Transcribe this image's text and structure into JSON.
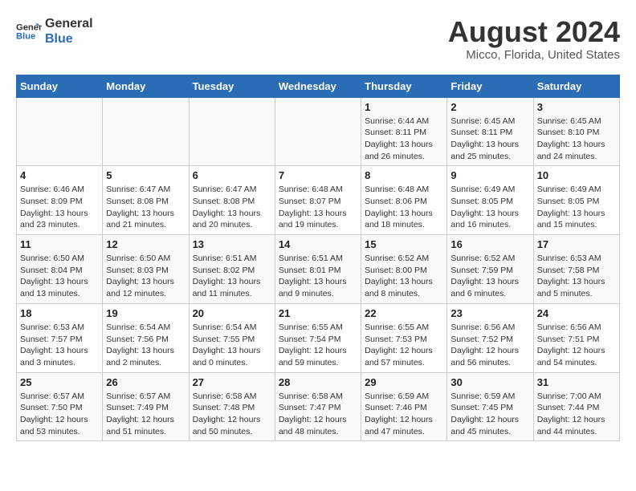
{
  "logo": {
    "line1": "General",
    "line2": "Blue"
  },
  "title": "August 2024",
  "location": "Micco, Florida, United States",
  "days_header": [
    "Sunday",
    "Monday",
    "Tuesday",
    "Wednesday",
    "Thursday",
    "Friday",
    "Saturday"
  ],
  "weeks": [
    [
      {
        "num": "",
        "info": ""
      },
      {
        "num": "",
        "info": ""
      },
      {
        "num": "",
        "info": ""
      },
      {
        "num": "",
        "info": ""
      },
      {
        "num": "1",
        "info": "Sunrise: 6:44 AM\nSunset: 8:11 PM\nDaylight: 13 hours\nand 26 minutes."
      },
      {
        "num": "2",
        "info": "Sunrise: 6:45 AM\nSunset: 8:11 PM\nDaylight: 13 hours\nand 25 minutes."
      },
      {
        "num": "3",
        "info": "Sunrise: 6:45 AM\nSunset: 8:10 PM\nDaylight: 13 hours\nand 24 minutes."
      }
    ],
    [
      {
        "num": "4",
        "info": "Sunrise: 6:46 AM\nSunset: 8:09 PM\nDaylight: 13 hours\nand 23 minutes."
      },
      {
        "num": "5",
        "info": "Sunrise: 6:47 AM\nSunset: 8:08 PM\nDaylight: 13 hours\nand 21 minutes."
      },
      {
        "num": "6",
        "info": "Sunrise: 6:47 AM\nSunset: 8:08 PM\nDaylight: 13 hours\nand 20 minutes."
      },
      {
        "num": "7",
        "info": "Sunrise: 6:48 AM\nSunset: 8:07 PM\nDaylight: 13 hours\nand 19 minutes."
      },
      {
        "num": "8",
        "info": "Sunrise: 6:48 AM\nSunset: 8:06 PM\nDaylight: 13 hours\nand 18 minutes."
      },
      {
        "num": "9",
        "info": "Sunrise: 6:49 AM\nSunset: 8:05 PM\nDaylight: 13 hours\nand 16 minutes."
      },
      {
        "num": "10",
        "info": "Sunrise: 6:49 AM\nSunset: 8:05 PM\nDaylight: 13 hours\nand 15 minutes."
      }
    ],
    [
      {
        "num": "11",
        "info": "Sunrise: 6:50 AM\nSunset: 8:04 PM\nDaylight: 13 hours\nand 13 minutes."
      },
      {
        "num": "12",
        "info": "Sunrise: 6:50 AM\nSunset: 8:03 PM\nDaylight: 13 hours\nand 12 minutes."
      },
      {
        "num": "13",
        "info": "Sunrise: 6:51 AM\nSunset: 8:02 PM\nDaylight: 13 hours\nand 11 minutes."
      },
      {
        "num": "14",
        "info": "Sunrise: 6:51 AM\nSunset: 8:01 PM\nDaylight: 13 hours\nand 9 minutes."
      },
      {
        "num": "15",
        "info": "Sunrise: 6:52 AM\nSunset: 8:00 PM\nDaylight: 13 hours\nand 8 minutes."
      },
      {
        "num": "16",
        "info": "Sunrise: 6:52 AM\nSunset: 7:59 PM\nDaylight: 13 hours\nand 6 minutes."
      },
      {
        "num": "17",
        "info": "Sunrise: 6:53 AM\nSunset: 7:58 PM\nDaylight: 13 hours\nand 5 minutes."
      }
    ],
    [
      {
        "num": "18",
        "info": "Sunrise: 6:53 AM\nSunset: 7:57 PM\nDaylight: 13 hours\nand 3 minutes."
      },
      {
        "num": "19",
        "info": "Sunrise: 6:54 AM\nSunset: 7:56 PM\nDaylight: 13 hours\nand 2 minutes."
      },
      {
        "num": "20",
        "info": "Sunrise: 6:54 AM\nSunset: 7:55 PM\nDaylight: 13 hours\nand 0 minutes."
      },
      {
        "num": "21",
        "info": "Sunrise: 6:55 AM\nSunset: 7:54 PM\nDaylight: 12 hours\nand 59 minutes."
      },
      {
        "num": "22",
        "info": "Sunrise: 6:55 AM\nSunset: 7:53 PM\nDaylight: 12 hours\nand 57 minutes."
      },
      {
        "num": "23",
        "info": "Sunrise: 6:56 AM\nSunset: 7:52 PM\nDaylight: 12 hours\nand 56 minutes."
      },
      {
        "num": "24",
        "info": "Sunrise: 6:56 AM\nSunset: 7:51 PM\nDaylight: 12 hours\nand 54 minutes."
      }
    ],
    [
      {
        "num": "25",
        "info": "Sunrise: 6:57 AM\nSunset: 7:50 PM\nDaylight: 12 hours\nand 53 minutes."
      },
      {
        "num": "26",
        "info": "Sunrise: 6:57 AM\nSunset: 7:49 PM\nDaylight: 12 hours\nand 51 minutes."
      },
      {
        "num": "27",
        "info": "Sunrise: 6:58 AM\nSunset: 7:48 PM\nDaylight: 12 hours\nand 50 minutes."
      },
      {
        "num": "28",
        "info": "Sunrise: 6:58 AM\nSunset: 7:47 PM\nDaylight: 12 hours\nand 48 minutes."
      },
      {
        "num": "29",
        "info": "Sunrise: 6:59 AM\nSunset: 7:46 PM\nDaylight: 12 hours\nand 47 minutes."
      },
      {
        "num": "30",
        "info": "Sunrise: 6:59 AM\nSunset: 7:45 PM\nDaylight: 12 hours\nand 45 minutes."
      },
      {
        "num": "31",
        "info": "Sunrise: 7:00 AM\nSunset: 7:44 PM\nDaylight: 12 hours\nand 44 minutes."
      }
    ]
  ]
}
